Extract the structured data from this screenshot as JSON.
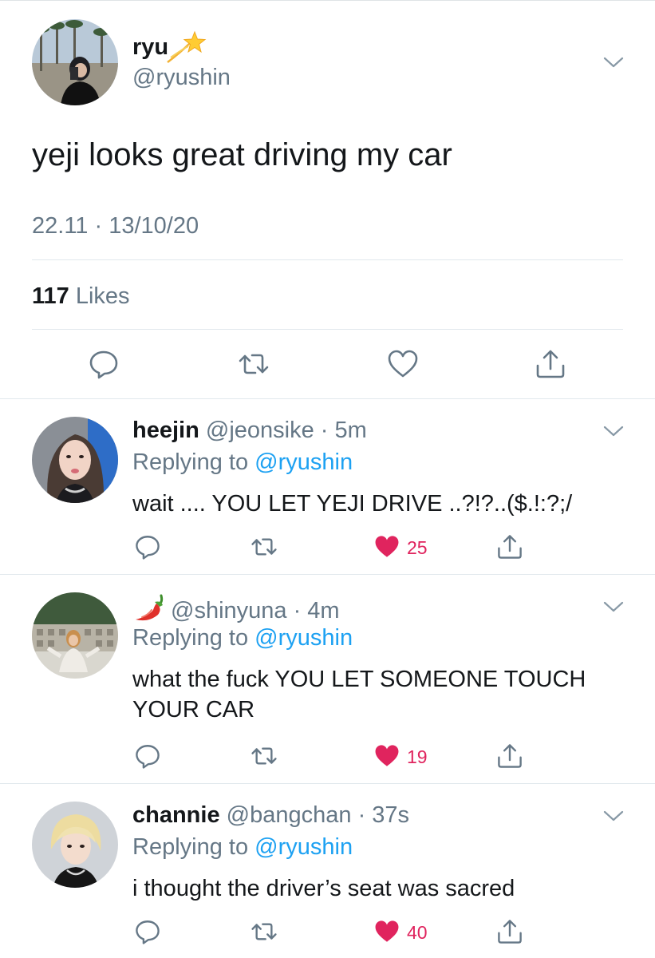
{
  "main_tweet": {
    "display_name": "ryu",
    "name_emoji": "sparkle-star-emoji",
    "handle": "@ryushin",
    "text": "yeji looks great driving my car",
    "timestamp": "22.11 · 13/10/20",
    "likes_count": "117",
    "likes_label": "Likes",
    "actions": [
      "reply-icon",
      "retweet-icon",
      "like-icon",
      "share-icon"
    ]
  },
  "replies": [
    {
      "name": "heejin",
      "handle": "@jeonsike",
      "time": "· 5m",
      "replying_prefix": "Replying to",
      "replying_to": "@ryushin",
      "text": "wait .... YOU LET YEJI DRIVE ..?!?..($.!:?;/",
      "likes": "25"
    },
    {
      "name_emoji": "hot-pepper-emoji",
      "handle": "@shinyuna",
      "time": "· 4m",
      "replying_prefix": "Replying to",
      "replying_to": "@ryushin",
      "text": "what the fuck YOU LET SOMEONE TOUCH YOUR CAR",
      "likes": "19"
    },
    {
      "name": "channie",
      "handle": "@bangchan",
      "time": "· 37s",
      "replying_prefix": "Replying to",
      "replying_to": "@ryushin",
      "text": "i thought the driver’s seat was sacred",
      "likes": "40"
    }
  ],
  "colors": {
    "text": "#14171a",
    "secondary": "#657786",
    "link": "#1da1f2",
    "like": "#e0245e",
    "divider": "#e1e8ed"
  }
}
